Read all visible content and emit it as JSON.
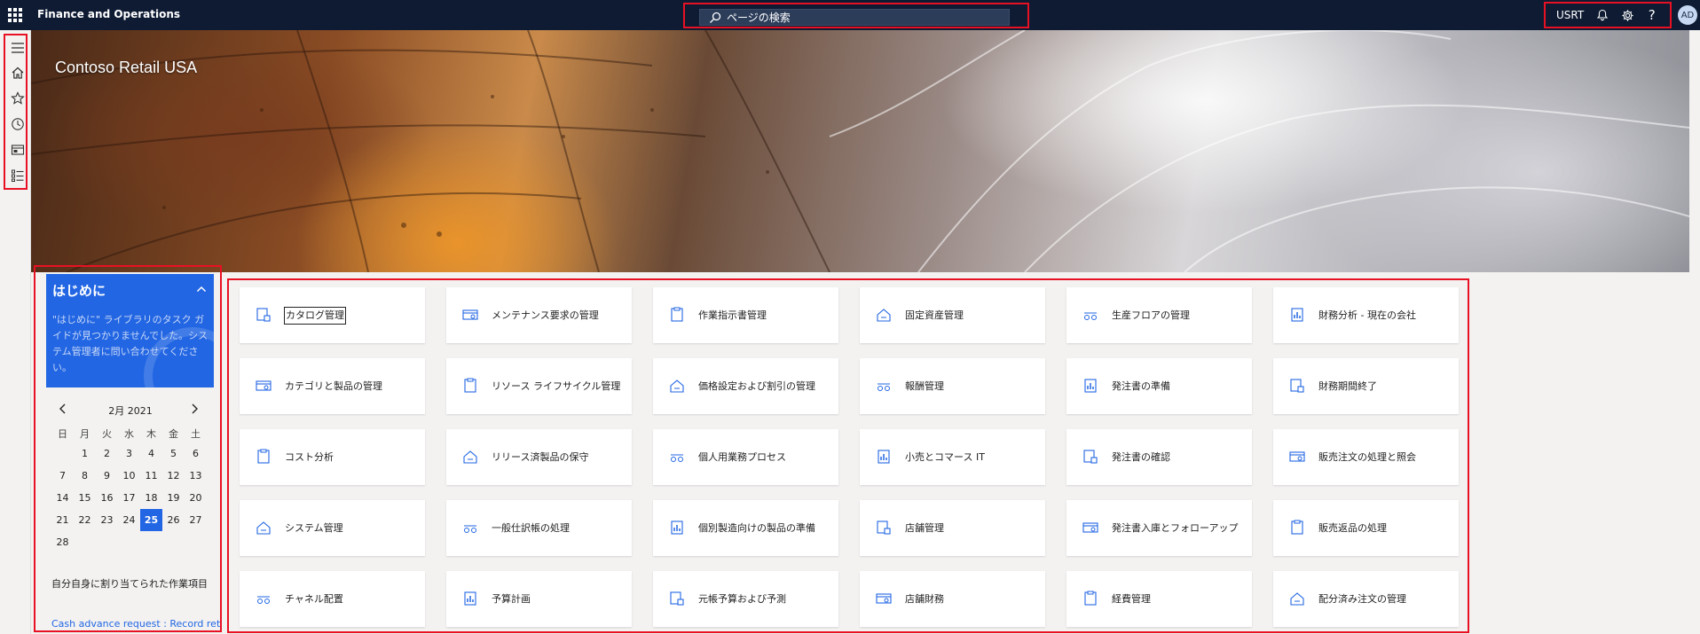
{
  "app": {
    "title": "Finance and Operations"
  },
  "search": {
    "placeholder": "ページの検索"
  },
  "header": {
    "company": "USRT",
    "avatar_initials": "AD"
  },
  "banner": {
    "title": "Contoso Retail USA"
  },
  "getting_started": {
    "title": "はじめに",
    "body": "\"はじめに\" ライブラリのタスク ガイドが見つかりませんでした。システム管理者に問い合わせてください。"
  },
  "calendar": {
    "month_label": "2月  2021",
    "weekdays": [
      "日",
      "月",
      "火",
      "水",
      "木",
      "金",
      "土"
    ],
    "weeks": [
      [
        "",
        "1",
        "2",
        "3",
        "4",
        "5",
        "6"
      ],
      [
        "7",
        "8",
        "9",
        "10",
        "11",
        "12",
        "13"
      ],
      [
        "14",
        "15",
        "16",
        "17",
        "18",
        "19",
        "20"
      ],
      [
        "21",
        "22",
        "23",
        "24",
        "25",
        "26",
        "27"
      ],
      [
        "28",
        "",
        "",
        "",
        "",
        "",
        ""
      ]
    ],
    "today": "25"
  },
  "assigned": {
    "title": "自分自身に割り当てられた作業項目",
    "link": "Cash advance request : Record ret..."
  },
  "tiles": [
    [
      "カタログ管理",
      "メンテナンス要求の管理",
      "作業指示書管理",
      "固定資産管理",
      "生産フロアの管理",
      "財務分析 - 現在の会社"
    ],
    [
      "カテゴリと製品の管理",
      "リソース ライフサイクル管理",
      "価格設定および割引の管理",
      "報酬管理",
      "発注書の準備",
      "財務期間終了"
    ],
    [
      "コスト分析",
      "リリース済製品の保守",
      "個人用業務プロセス",
      "小売とコマース IT",
      "発注書の確認",
      "販売注文の処理と照会"
    ],
    [
      "システム管理",
      "一般仕訳帳の処理",
      "個別製造向けの製品の準備",
      "店舗管理",
      "発注書入庫とフォローアップ",
      "販売返品の処理"
    ],
    [
      "チャネル配置",
      "予算計画",
      "元帳予算および予測",
      "店舗財務",
      "経費管理",
      "配分済み注文の管理"
    ]
  ],
  "colors": {
    "topbar": "#0e1b33",
    "accent": "#2266e3",
    "highlight": "#e81123"
  }
}
